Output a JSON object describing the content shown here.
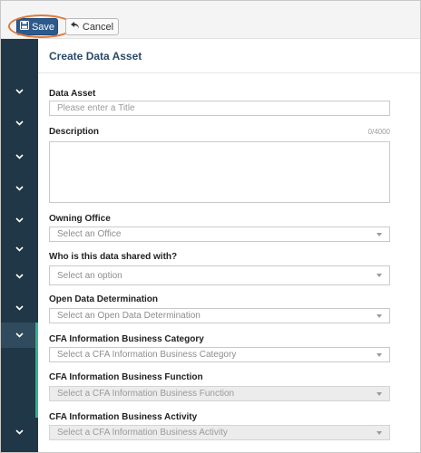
{
  "toolbar": {
    "save_label": "Save",
    "cancel_label": "Cancel"
  },
  "page": {
    "title": "Create Data Asset"
  },
  "form": {
    "data_asset": {
      "label": "Data Asset",
      "placeholder": "Please enter a Title"
    },
    "description": {
      "label": "Description",
      "counter": "0/4000"
    },
    "owning_office": {
      "label": "Owning Office",
      "placeholder": "Select an Office"
    },
    "shared_with": {
      "label": "Who is this data shared with?",
      "placeholder": "Select an option"
    },
    "open_data": {
      "label": "Open Data Determination",
      "placeholder": "Select an Open Data Determination"
    },
    "business_category": {
      "label": "CFA Information Business Category",
      "placeholder": "Select a CFA Information Business Category"
    },
    "business_function": {
      "label": "CFA Information Business Function",
      "placeholder": "Select a CFA Information Business Function"
    },
    "business_activity": {
      "label": "CFA Information Business Activity",
      "placeholder": "Select a CFA Information Business Activity"
    }
  },
  "icons": {
    "save": "floppy-disk-icon",
    "cancel": "undo-arrow-icon",
    "sidebar": "chevron-down-icon",
    "dropdown": "caret-down-icon"
  },
  "colors": {
    "sidebar": "#203748",
    "save_button": "#2d5a8c",
    "highlight_ring": "#e07a3a",
    "sidebar_accent": "#2fb28d",
    "title": "#2a4a6a"
  }
}
